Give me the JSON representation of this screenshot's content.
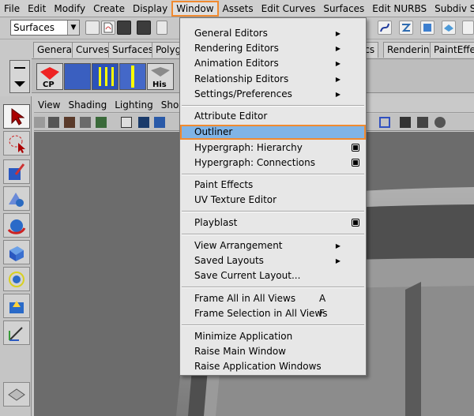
{
  "menubar": {
    "items": [
      "File",
      "Edit",
      "Modify",
      "Create",
      "Display",
      "Window",
      "Assets",
      "Edit Curves",
      "Surfaces",
      "Edit NURBS",
      "Subdiv Su"
    ],
    "active": "Window"
  },
  "statusline": {
    "mode": "Surfaces"
  },
  "shelf": {
    "tabs": [
      "General",
      "Curves",
      "Surfaces",
      "Polyg",
      "ics",
      "Rendering",
      "PaintEffe"
    ],
    "icon_labels": [
      "CP",
      "His"
    ]
  },
  "panel": {
    "menu": [
      "View",
      "Shading",
      "Lighting",
      "Show"
    ]
  },
  "window_menu": {
    "items": [
      {
        "label": "General Editors",
        "submenu": true
      },
      {
        "label": "Rendering Editors",
        "submenu": true
      },
      {
        "label": "Animation Editors",
        "submenu": true
      },
      {
        "label": "Relationship Editors",
        "submenu": true
      },
      {
        "label": "Settings/Preferences",
        "submenu": true
      },
      {
        "label": "Attribute Editor"
      },
      {
        "label": "Outliner",
        "highlighted": true
      },
      {
        "label": "Hypergraph: Hierarchy",
        "option_box": true
      },
      {
        "label": "Hypergraph: Connections",
        "option_box": true
      },
      {
        "label": "Paint Effects"
      },
      {
        "label": "UV Texture Editor"
      },
      {
        "label": "Playblast",
        "option_box": true
      },
      {
        "label": "View Arrangement",
        "submenu": true
      },
      {
        "label": "Saved Layouts",
        "submenu": true
      },
      {
        "label": "Save Current Layout..."
      },
      {
        "label": "Frame All in All Views",
        "shortcut": "A"
      },
      {
        "label": "Frame Selection in All Views",
        "shortcut": "F"
      },
      {
        "label": "Minimize Application"
      },
      {
        "label": "Raise Main Window"
      },
      {
        "label": "Raise Application Windows"
      }
    ]
  },
  "colors": {
    "highlight_border": "#f08a30",
    "highlight_fill": "#80b4e6",
    "menu_bg": "#e7e7e7",
    "ui_gray": "#c8c8c8"
  },
  "icons": {
    "submenu": "triangle-right-icon",
    "option_box": "option-box-icon",
    "select_tool": "arrow-cursor-icon",
    "lasso_tool": "lasso-icon",
    "paint_tool": "paint-brush-icon",
    "move_tool": "move-icon",
    "rotate_tool": "rotate-icon",
    "scale_tool": "scale-icon",
    "manip_tool": "universal-manipulator-icon"
  }
}
